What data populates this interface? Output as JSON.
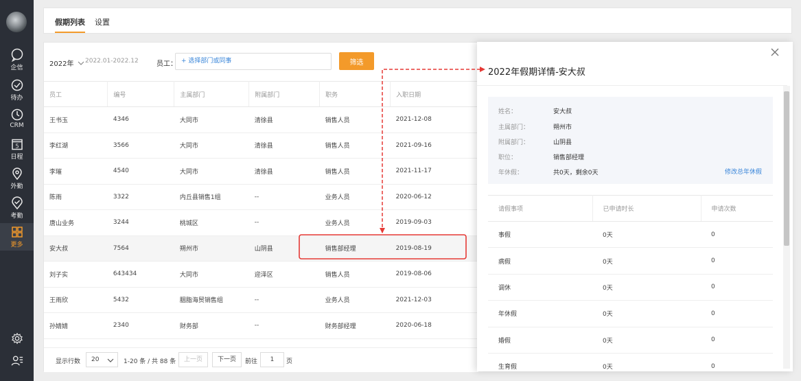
{
  "nav": {
    "items": [
      {
        "name": "nav-qixin",
        "label": "企信",
        "icon": "chat-icon"
      },
      {
        "name": "nav-todo",
        "label": "待办",
        "icon": "check-circle-icon"
      },
      {
        "name": "nav-crm",
        "label": "CRM",
        "icon": "clock-icon"
      },
      {
        "name": "nav-schedule",
        "label": "日程",
        "icon": "calendar-icon"
      },
      {
        "name": "nav-field",
        "label": "外勤",
        "icon": "location-pin-icon"
      },
      {
        "name": "nav-attendance",
        "label": "考勤",
        "icon": "location-check-icon"
      },
      {
        "name": "nav-more",
        "label": "更多",
        "icon": "grid-icon",
        "active": true
      }
    ],
    "calendar_day": "5"
  },
  "tabs": [
    {
      "label": "假期列表",
      "active": true
    },
    {
      "label": "设置",
      "active": false
    }
  ],
  "filter": {
    "year": "2022年",
    "range": "2022.01-2022.12",
    "employee_label": "员工：",
    "employee_placeholder": "+ 选择部门或同事",
    "button": "筛选"
  },
  "table": {
    "headers": [
      "员工",
      "编号",
      "主属部门",
      "附属部门",
      "职务",
      "入职日期"
    ],
    "rows": [
      [
        "王书玉",
        "4346",
        "大同市",
        "清徐县",
        "销售人员",
        "2021-12-08"
      ],
      [
        "李红湖",
        "3566",
        "大同市",
        "清徐县",
        "销售人员",
        "2021-09-16"
      ],
      [
        "李璀",
        "4540",
        "大同市",
        "清徐县",
        "销售人员",
        "2021-11-17"
      ],
      [
        "陈雨",
        "3322",
        "内丘县销售1组",
        "--",
        "业务人员",
        "2020-06-12"
      ],
      [
        "唐山业务",
        "3244",
        "桃城区",
        "--",
        "业务人员",
        "2019-09-03"
      ],
      [
        "安大叔",
        "7564",
        "朔州市",
        "山阴县",
        "销售部经理",
        "2019-08-19"
      ],
      [
        "刘子实",
        "643434",
        "大同市",
        "迎泽区",
        "销售人员",
        "2019-08-06"
      ],
      [
        "王雨欣",
        "5432",
        "胭脂海贸销售组",
        "--",
        "业务人员",
        "2021-12-03"
      ],
      [
        "孙婧婧",
        "2340",
        "财务部",
        "--",
        "财务部经理",
        "2020-06-18"
      ]
    ],
    "highlighted_row": 5
  },
  "pager": {
    "rows_label": "显示行数",
    "page_size": "20",
    "summary": "1-20 条 / 共 88 条",
    "prev": "上一页",
    "next": "下一页",
    "goto_label": "前往",
    "page": "1",
    "page_unit": "页"
  },
  "drawer": {
    "title": "2022年假期详情-安大叔",
    "info": [
      {
        "key": "姓名：",
        "value": "安大叔"
      },
      {
        "key": "主属部门：",
        "value": "朔州市"
      },
      {
        "key": "附属部门：",
        "value": "山阴县"
      },
      {
        "key": "职位：",
        "value": "销售部经理"
      },
      {
        "key": "年休假：",
        "value": "共0天，剩余0天"
      }
    ],
    "edit_link": "修改总年休假",
    "leave_headers": [
      "请假事项",
      "已申请时长",
      "申请次数"
    ],
    "leave_rows": [
      [
        "事假",
        "0天",
        "0"
      ],
      [
        "病假",
        "0天",
        "0"
      ],
      [
        "调休",
        "0天",
        "0"
      ],
      [
        "年休假",
        "0天",
        "0"
      ],
      [
        "婚假",
        "0天",
        "0"
      ],
      [
        "生育假",
        "0天",
        "0"
      ]
    ]
  },
  "colors": {
    "accent": "#f39a2a",
    "link": "#3a86d9",
    "annotation_red": "#e53935"
  }
}
